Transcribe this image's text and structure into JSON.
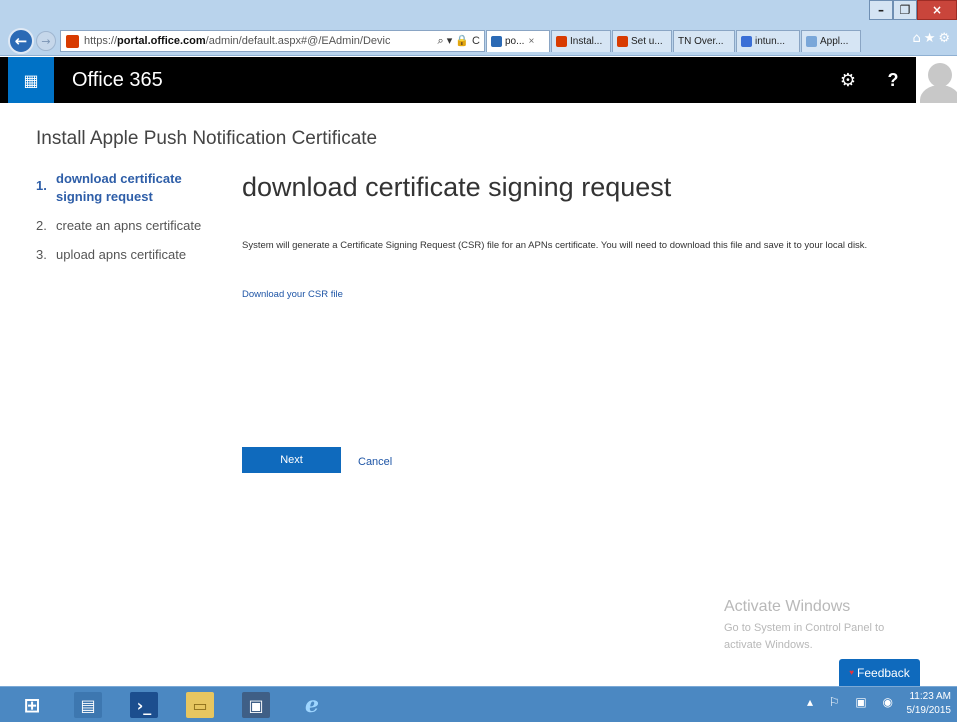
{
  "browser": {
    "window_controls": {
      "minimize": "–",
      "restore": "❐",
      "close": "×"
    },
    "address": {
      "prefix": "https://",
      "host": "portal.office.com",
      "path": "/admin/default.aspx#@/EAdmin/Devic",
      "tools": "⌕ ▾ 🔒 C"
    },
    "tabs": [
      {
        "label": "po...",
        "close": "×",
        "icon_color": "#2b6ab5",
        "active": true
      },
      {
        "label": "Instal...",
        "icon_color": "#d83b01"
      },
      {
        "label": "Set u...",
        "icon_color": "#d83b01"
      },
      {
        "label": "TN Over...",
        "icon_color": ""
      },
      {
        "label": "intun...",
        "icon_color": "#3b6fd6"
      },
      {
        "label": "Appl...",
        "icon_color": "#7aa7d9"
      }
    ],
    "right_icons": "⌂★⚙"
  },
  "header": {
    "brand": "Office 365",
    "launcher_icon": "app-launcher-icon",
    "settings_icon": "⚙",
    "help_label": "?"
  },
  "page": {
    "title": "Install Apple Push Notification Certificate",
    "steps": [
      {
        "num": "1.",
        "label": "download certificate signing request",
        "active": true
      },
      {
        "num": "2.",
        "label": "create an apns certificate"
      },
      {
        "num": "3.",
        "label": "upload apns certificate"
      }
    ],
    "heading": "download certificate signing request",
    "description": "System will generate a Certificate Signing Request (CSR) file for an APNs certificate. You will need to download this file and save it to your local disk.",
    "csr_link": "Download your CSR file",
    "next_label": "Next",
    "cancel_label": "Cancel"
  },
  "watermark": {
    "title": "Activate Windows",
    "line1": "Go to System in Control Panel to",
    "line2": "activate Windows."
  },
  "feedback": {
    "label": "Feedback"
  },
  "taskbar": {
    "tray_icons": "▴ ⚐ ▣ ◉",
    "time": "11:23 AM",
    "date": "5/19/2015"
  },
  "colors": {
    "accent": "#0f6abd",
    "link": "#1e55a6",
    "header_bg": "#000000"
  }
}
